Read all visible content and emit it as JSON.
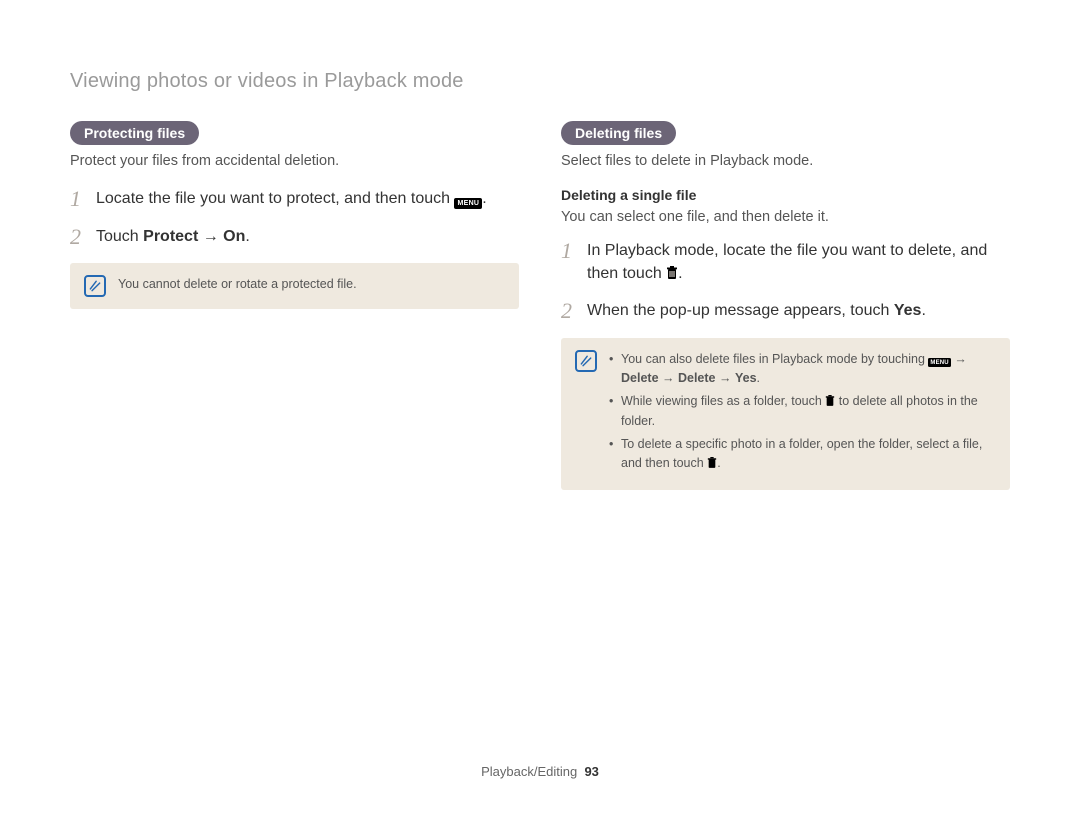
{
  "page_title": "Viewing photos or videos in Playback mode",
  "left": {
    "heading": "Protecting files",
    "intro": "Protect your files from accidental deletion.",
    "steps": [
      {
        "num": "1",
        "pre": "Locate the file you want to protect, and then touch ",
        "icon": "menu",
        "post": "."
      },
      {
        "num": "2",
        "pre": "Touch ",
        "bold1": "Protect",
        "mid": " → ",
        "bold2": "On",
        "post": "."
      }
    ],
    "note": "You cannot delete or rotate a protected file."
  },
  "right": {
    "heading": "Deleting files",
    "intro": "Select files to delete in Playback mode.",
    "subheading": "Deleting a single file",
    "subintro": "You can select one file, and then delete it.",
    "steps": [
      {
        "num": "1",
        "pre": "In Playback mode, locate the file you want to delete, and then touch ",
        "icon": "trash",
        "post": "."
      },
      {
        "num": "2",
        "pre": "When the pop-up message appears, touch ",
        "bold1": "Yes",
        "post": "."
      }
    ],
    "notes": [
      {
        "t1": "You can also delete files in Playback mode by touching ",
        "icon1": "menu-small",
        "t2": " → ",
        "b1": "Delete",
        "t3": " → ",
        "b2": "Delete",
        "t4": " → ",
        "b3": "Yes",
        "t5": "."
      },
      {
        "t1": "While viewing files as a folder, touch ",
        "icon1": "trash-small",
        "t2": " to delete all photos in the folder."
      },
      {
        "t1": "To delete a specific photo in a folder, open the folder, select a file, and then touch ",
        "icon1": "trash-small",
        "t2": "."
      }
    ]
  },
  "footer": {
    "section": "Playback/Editing",
    "page": "93"
  },
  "icons": {
    "menu": "MENU",
    "menu_small": "MENU"
  }
}
